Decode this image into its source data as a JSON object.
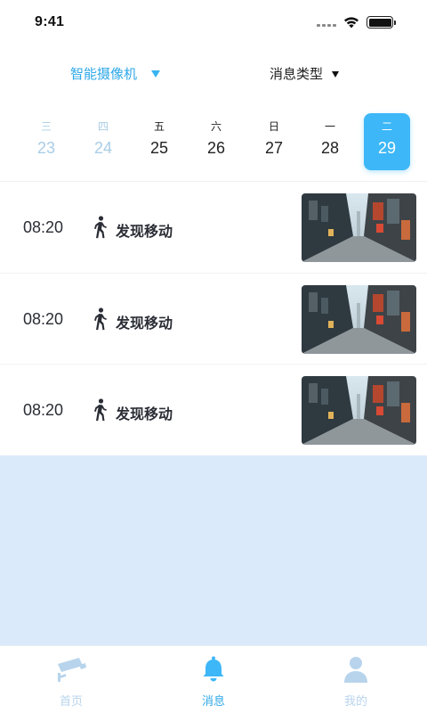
{
  "status_bar": {
    "time": "9:41"
  },
  "filters": {
    "camera": {
      "label": "智能摄像机"
    },
    "type": {
      "label": "消息类型"
    }
  },
  "dates": [
    {
      "weekday": "三",
      "day": "23",
      "state": "muted"
    },
    {
      "weekday": "四",
      "day": "24",
      "state": "muted"
    },
    {
      "weekday": "五",
      "day": "25",
      "state": "normal"
    },
    {
      "weekday": "六",
      "day": "26",
      "state": "normal"
    },
    {
      "weekday": "日",
      "day": "27",
      "state": "normal"
    },
    {
      "weekday": "一",
      "day": "28",
      "state": "normal"
    },
    {
      "weekday": "二",
      "day": "29",
      "state": "selected"
    }
  ],
  "events": [
    {
      "time": "08:20",
      "label": "发现移动",
      "icon": "walking-person-icon"
    },
    {
      "time": "08:20",
      "label": "发现移动",
      "icon": "walking-person-icon"
    },
    {
      "time": "08:20",
      "label": "发现移动",
      "icon": "walking-person-icon"
    }
  ],
  "tabs": [
    {
      "label": "首页",
      "icon": "camera-icon",
      "active": false
    },
    {
      "label": "消息",
      "icon": "bell-icon",
      "active": true
    },
    {
      "label": "我的",
      "icon": "user-icon",
      "active": false
    }
  ],
  "colors": {
    "accent": "#3db7f7",
    "accent_text": "#2ea8e8",
    "muted_date": "#a9cde6",
    "empty_background": "#dbeafb",
    "inactive_tab": "#b8d4ec"
  }
}
